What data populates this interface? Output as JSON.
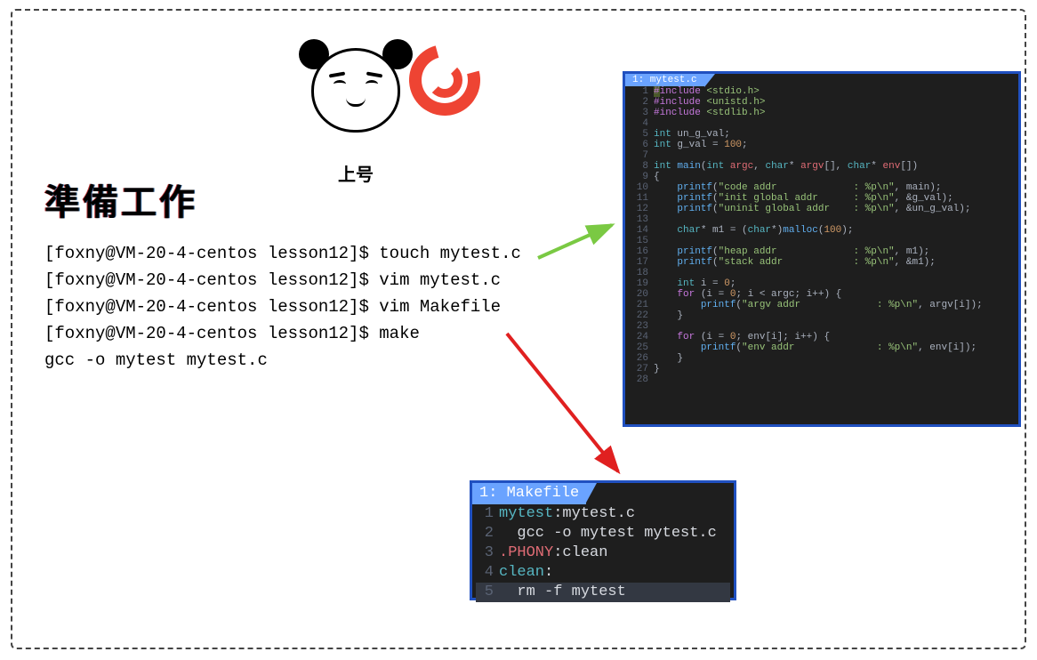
{
  "title": "準備工作",
  "panda_caption": "上号",
  "terminal": {
    "prompt": "[foxny@VM-20-4-centos lesson12]$ ",
    "lines": [
      "touch mytest.c",
      "vim mytest.c",
      "vim Makefile",
      "make"
    ],
    "output": "gcc -o mytest mytest.c"
  },
  "code_c": {
    "tab": "1: mytest.c",
    "lines": [
      {
        "n": 1,
        "seg": [
          {
            "c": "hl",
            "t": "#"
          },
          {
            "c": "pp",
            "t": "include "
          },
          {
            "c": "path",
            "t": "<stdio.h>"
          }
        ]
      },
      {
        "n": 2,
        "seg": [
          {
            "c": "pp",
            "t": "#include "
          },
          {
            "c": "path",
            "t": "<unistd.h>"
          }
        ]
      },
      {
        "n": 3,
        "seg": [
          {
            "c": "pp",
            "t": "#include "
          },
          {
            "c": "path",
            "t": "<stdlib.h>"
          }
        ]
      },
      {
        "n": 4,
        "seg": []
      },
      {
        "n": 5,
        "seg": [
          {
            "c": "ty",
            "t": "int"
          },
          {
            "c": "id",
            "t": " un_g_val;"
          }
        ]
      },
      {
        "n": 6,
        "seg": [
          {
            "c": "ty",
            "t": "int"
          },
          {
            "c": "id",
            "t": " g_val = "
          },
          {
            "c": "num",
            "t": "100"
          },
          {
            "c": "id",
            "t": ";"
          }
        ]
      },
      {
        "n": 7,
        "seg": []
      },
      {
        "n": 8,
        "seg": [
          {
            "c": "ty",
            "t": "int"
          },
          {
            "c": "id",
            "t": " "
          },
          {
            "c": "fn",
            "t": "main"
          },
          {
            "c": "id",
            "t": "("
          },
          {
            "c": "ty",
            "t": "int"
          },
          {
            "c": "id",
            "t": " "
          },
          {
            "c": "idr",
            "t": "argc"
          },
          {
            "c": "id",
            "t": ", "
          },
          {
            "c": "ty",
            "t": "char"
          },
          {
            "c": "id",
            "t": "* "
          },
          {
            "c": "idr",
            "t": "argv"
          },
          {
            "c": "id",
            "t": "[], "
          },
          {
            "c": "ty",
            "t": "char"
          },
          {
            "c": "id",
            "t": "* "
          },
          {
            "c": "idr",
            "t": "env"
          },
          {
            "c": "id",
            "t": "[])"
          }
        ]
      },
      {
        "n": 9,
        "seg": [
          {
            "c": "id",
            "t": "{"
          }
        ]
      },
      {
        "n": 10,
        "seg": [
          {
            "c": "id",
            "t": "    "
          },
          {
            "c": "fn",
            "t": "printf"
          },
          {
            "c": "id",
            "t": "("
          },
          {
            "c": "str",
            "t": "\"code addr             : %p\\n\""
          },
          {
            "c": "id",
            "t": ", main);"
          }
        ]
      },
      {
        "n": 11,
        "seg": [
          {
            "c": "id",
            "t": "    "
          },
          {
            "c": "fn",
            "t": "printf"
          },
          {
            "c": "id",
            "t": "("
          },
          {
            "c": "str",
            "t": "\"init global addr      : %p\\n\""
          },
          {
            "c": "id",
            "t": ", &g_val);"
          }
        ]
      },
      {
        "n": 12,
        "seg": [
          {
            "c": "id",
            "t": "    "
          },
          {
            "c": "fn",
            "t": "printf"
          },
          {
            "c": "id",
            "t": "("
          },
          {
            "c": "str",
            "t": "\"uninit global addr    : %p\\n\""
          },
          {
            "c": "id",
            "t": ", &un_g_val);"
          }
        ]
      },
      {
        "n": 13,
        "seg": []
      },
      {
        "n": 14,
        "seg": [
          {
            "c": "id",
            "t": "    "
          },
          {
            "c": "ty",
            "t": "char"
          },
          {
            "c": "id",
            "t": "* m1 = ("
          },
          {
            "c": "ty",
            "t": "char"
          },
          {
            "c": "id",
            "t": "*)"
          },
          {
            "c": "fn",
            "t": "malloc"
          },
          {
            "c": "id",
            "t": "("
          },
          {
            "c": "num",
            "t": "100"
          },
          {
            "c": "id",
            "t": ");"
          }
        ]
      },
      {
        "n": 15,
        "seg": []
      },
      {
        "n": 16,
        "seg": [
          {
            "c": "id",
            "t": "    "
          },
          {
            "c": "fn",
            "t": "printf"
          },
          {
            "c": "id",
            "t": "("
          },
          {
            "c": "str",
            "t": "\"heap addr             : %p\\n\""
          },
          {
            "c": "id",
            "t": ", m1);"
          }
        ]
      },
      {
        "n": 17,
        "seg": [
          {
            "c": "id",
            "t": "    "
          },
          {
            "c": "fn",
            "t": "printf"
          },
          {
            "c": "id",
            "t": "("
          },
          {
            "c": "str",
            "t": "\"stack addr            : %p\\n\""
          },
          {
            "c": "id",
            "t": ", &m1);"
          }
        ]
      },
      {
        "n": 18,
        "seg": []
      },
      {
        "n": 19,
        "seg": [
          {
            "c": "id",
            "t": "    "
          },
          {
            "c": "ty",
            "t": "int"
          },
          {
            "c": "id",
            "t": " i = "
          },
          {
            "c": "num",
            "t": "0"
          },
          {
            "c": "id",
            "t": ";"
          }
        ]
      },
      {
        "n": 20,
        "seg": [
          {
            "c": "id",
            "t": "    "
          },
          {
            "c": "kw",
            "t": "for"
          },
          {
            "c": "id",
            "t": " (i = "
          },
          {
            "c": "num",
            "t": "0"
          },
          {
            "c": "id",
            "t": "; i < argc; i++) {"
          }
        ]
      },
      {
        "n": 21,
        "seg": [
          {
            "c": "id",
            "t": "        "
          },
          {
            "c": "fn",
            "t": "printf"
          },
          {
            "c": "id",
            "t": "("
          },
          {
            "c": "str",
            "t": "\"argv addr             : %p\\n\""
          },
          {
            "c": "id",
            "t": ", argv[i]);"
          }
        ]
      },
      {
        "n": 22,
        "seg": [
          {
            "c": "id",
            "t": "    }"
          }
        ]
      },
      {
        "n": 23,
        "seg": []
      },
      {
        "n": 24,
        "seg": [
          {
            "c": "id",
            "t": "    "
          },
          {
            "c": "kw",
            "t": "for"
          },
          {
            "c": "id",
            "t": " (i = "
          },
          {
            "c": "num",
            "t": "0"
          },
          {
            "c": "id",
            "t": "; env[i]; i++) {"
          }
        ]
      },
      {
        "n": 25,
        "seg": [
          {
            "c": "id",
            "t": "        "
          },
          {
            "c": "fn",
            "t": "printf"
          },
          {
            "c": "id",
            "t": "("
          },
          {
            "c": "str",
            "t": "\"env addr              : %p\\n\""
          },
          {
            "c": "id",
            "t": ", env[i]);"
          }
        ]
      },
      {
        "n": 26,
        "seg": [
          {
            "c": "id",
            "t": "    }"
          }
        ]
      },
      {
        "n": 27,
        "seg": [
          {
            "c": "id",
            "t": "}"
          }
        ]
      },
      {
        "n": 28,
        "seg": []
      }
    ]
  },
  "code_mk": {
    "tab": "1: Makefile",
    "lines": [
      {
        "n": 1,
        "seg": [
          {
            "c": "idc",
            "t": "mytest"
          },
          {
            "c": "white",
            "t": ":mytest.c"
          }
        ]
      },
      {
        "n": 2,
        "seg": [
          {
            "c": "white",
            "t": "  gcc -o mytest mytest.c"
          }
        ]
      },
      {
        "n": 3,
        "seg": [
          {
            "c": "phony",
            "t": ".PHONY"
          },
          {
            "c": "white",
            "t": ":clean"
          }
        ]
      },
      {
        "n": 4,
        "seg": [
          {
            "c": "idc",
            "t": "clean"
          },
          {
            "c": "white",
            "t": ":"
          }
        ]
      },
      {
        "n": 5,
        "cursor": true,
        "seg": [
          {
            "c": "white",
            "t": "  rm -f mytest"
          }
        ]
      }
    ]
  }
}
